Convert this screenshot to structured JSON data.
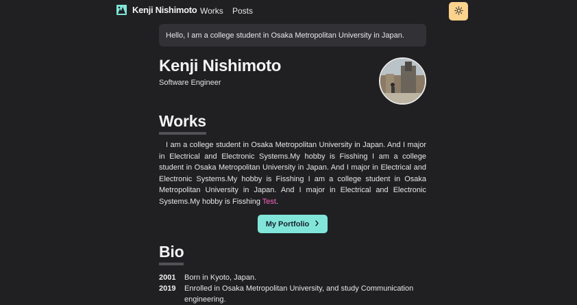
{
  "nav": {
    "brand_name": "Kenji Nishimoto",
    "brand_icon": "paw-logo-icon",
    "links": [
      {
        "label": "Works"
      },
      {
        "label": "Posts"
      }
    ],
    "theme_toggle_icon": "sun-icon"
  },
  "greeting": "Hello, I am a college student in Osaka Metropolitan University in Japan.",
  "profile": {
    "name": "Kenji Nishimoto",
    "role": "Software Engineer"
  },
  "works": {
    "heading": "Works",
    "paragraph": "I am a college student in Osaka Metropolitan University in Japan. And I major in Electrical and Electronic Systems.My hobby is Fisshing I am a college student in Osaka Metropolitan University in Japan. And I major in Electrical and Electronic Systems.My hobby is Fisshing I am a college student in Osaka Metropolitan University in Japan. And I major in Electrical and Electronic Systems.My hobby is Fisshing ",
    "link_label": "Test",
    "paragraph_end": ".",
    "button_label": "My Portfolio",
    "button_icon": "chevron-right-icon"
  },
  "bio": {
    "heading": "Bio",
    "entries": [
      {
        "year": "2001",
        "text": "Born in Kyoto, Japan."
      },
      {
        "year": "2019",
        "text": "Enrolled in Osaka Metropolitan University, and study Communication engineering."
      }
    ]
  },
  "colors": {
    "background": "#202023",
    "accent_button": "#81e6d9",
    "link": "#ff63c3",
    "toggle": "#fbd38d"
  }
}
